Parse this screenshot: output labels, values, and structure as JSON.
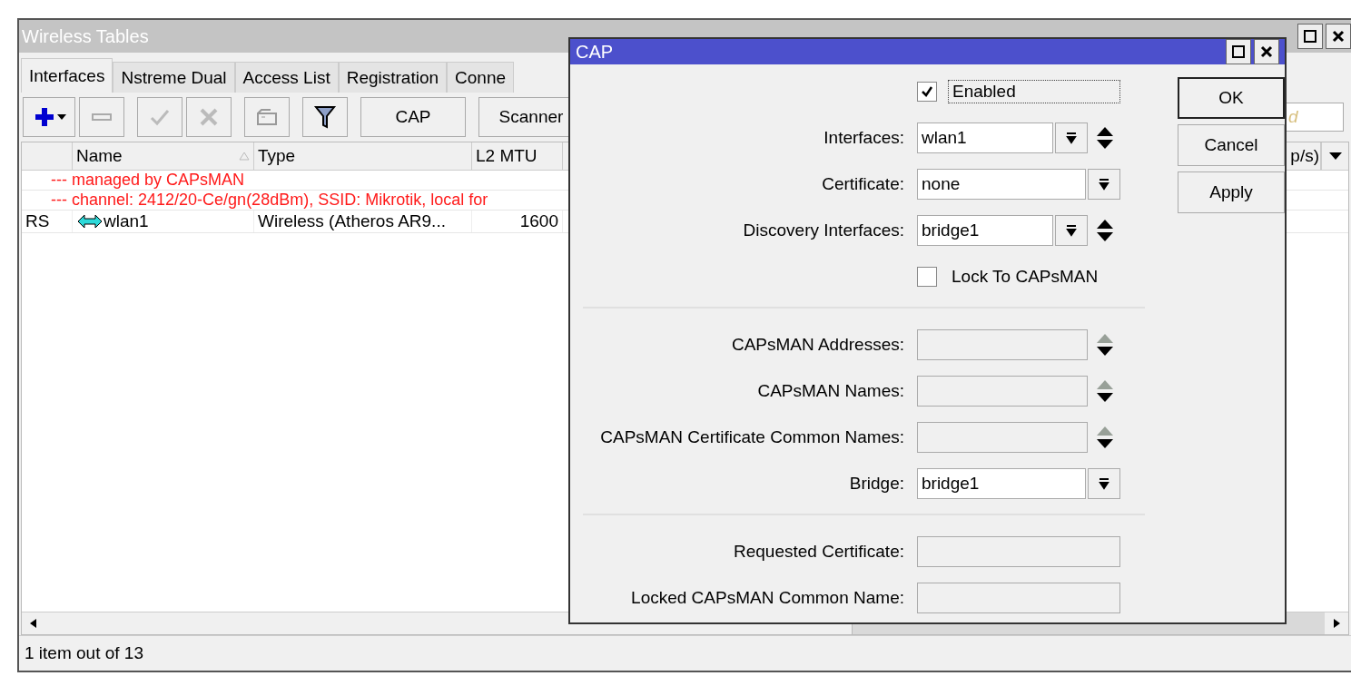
{
  "window": {
    "title": "Wireless Tables"
  },
  "tabs": [
    {
      "label": "Interfaces",
      "selected": true
    },
    {
      "label": "Nstreme Dual",
      "selected": false
    },
    {
      "label": "Access List",
      "selected": false
    },
    {
      "label": "Registration",
      "selected": false
    },
    {
      "label": "Conne",
      "selected": false
    }
  ],
  "toolbar": {
    "text_buttons": [
      "CAP",
      "Scanner"
    ],
    "search": {
      "placeholder": "d"
    }
  },
  "table": {
    "columns": [
      "Name",
      "Type",
      "L2 MTU",
      "p/s)"
    ],
    "groups": [
      "--- managed by CAPsMAN",
      "--- channel: 2412/20-Ce/gn(28dBm), SSID: Mikrotik, local for"
    ],
    "rows": [
      {
        "flags": "RS",
        "name": "wlan1",
        "type": "Wireless (Atheros AR9...",
        "l2mtu": "1600"
      }
    ]
  },
  "status_bar": "1 item out of 13",
  "dialog": {
    "title": "CAP",
    "sections": [
      [
        {
          "kind": "checkbox",
          "label": "Enabled",
          "checked": true
        },
        {
          "kind": "field",
          "label": "Interfaces:",
          "value": "wlan1",
          "dropdown": true,
          "updown": true,
          "disabled": false
        },
        {
          "kind": "field",
          "label": "Certificate:",
          "value": "none",
          "dropdown": true,
          "updown": false,
          "disabled": false
        },
        {
          "kind": "field",
          "label": "Discovery Interfaces:",
          "value": "bridge1",
          "dropdown": true,
          "updown": true,
          "disabled": false
        },
        {
          "kind": "checkbox",
          "label": "Lock To CAPsMAN",
          "checked": false
        }
      ],
      [
        {
          "kind": "field",
          "label": "CAPsMAN Addresses:",
          "dropdown": false,
          "updown": true,
          "disabled": true
        },
        {
          "kind": "field",
          "label": "CAPsMAN Names:",
          "dropdown": false,
          "updown": true,
          "disabled": true
        },
        {
          "kind": "field",
          "label": "CAPsMAN Certificate Common Names:",
          "dropdown": false,
          "updown": true,
          "disabled": true
        },
        {
          "kind": "field",
          "label": "Bridge:",
          "value": "bridge1",
          "dropdown": true,
          "updown": false,
          "disabled": false
        }
      ],
      [
        {
          "kind": "field",
          "label": "Requested Certificate:",
          "dropdown": false,
          "updown": false,
          "disabled": true
        },
        {
          "kind": "field",
          "label": "Locked CAPsMAN Common Name:",
          "dropdown": false,
          "updown": false,
          "disabled": true
        }
      ]
    ],
    "buttons": [
      "OK",
      "Cancel",
      "Apply"
    ]
  }
}
